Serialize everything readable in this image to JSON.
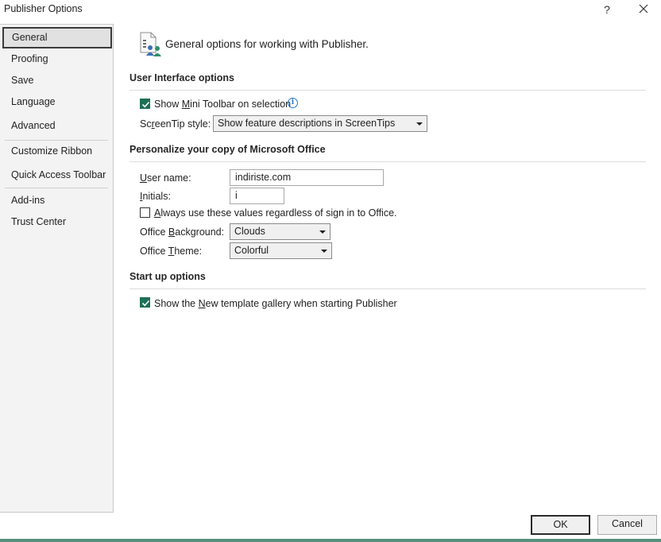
{
  "window": {
    "title": "Publisher Options",
    "help_label": "?",
    "close_icon": "close-icon"
  },
  "sidebar": {
    "items": [
      {
        "label": "General",
        "active": true
      },
      {
        "label": "Proofing"
      },
      {
        "label": "Save"
      },
      {
        "label": "Language"
      },
      {
        "label": "Advanced"
      },
      {
        "label": "Customize Ribbon"
      },
      {
        "label": "Quick Access Toolbar"
      },
      {
        "label": "Add-ins"
      },
      {
        "label": "Trust Center"
      }
    ]
  },
  "header": {
    "icon": "general-options-icon",
    "text": "General options for working with Publisher."
  },
  "ui_options": {
    "title": "User Interface options",
    "mini_toolbar": {
      "label_pre": "Show ",
      "label_u": "M",
      "label_post": "ini Toolbar on selection",
      "checked": true
    },
    "screentip": {
      "label_pre": "Sc",
      "label_u": "r",
      "label_post": "eenTip style:",
      "value": "Show feature descriptions in ScreenTips"
    }
  },
  "personalize": {
    "title": "Personalize your copy of Microsoft Office",
    "username": {
      "label_pre": "",
      "label_u": "U",
      "label_post": "ser name:",
      "value": "indiriste.com"
    },
    "initials": {
      "label_pre": "",
      "label_u": "I",
      "label_post": "nitials:",
      "value": "i"
    },
    "always_use": {
      "label_pre": "",
      "label_u": "A",
      "label_post": "lways use these values regardless of sign in to Office.",
      "checked": false
    },
    "background": {
      "label_pre": "Office ",
      "label_u": "B",
      "label_post": "ackground:",
      "value": "Clouds"
    },
    "theme": {
      "label_pre": "Office ",
      "label_u": "T",
      "label_post": "heme:",
      "value": "Colorful"
    }
  },
  "startup": {
    "title": "Start up options",
    "gallery": {
      "label_pre": "Show the ",
      "label_u": "N",
      "label_post": "ew template gallery when starting Publisher",
      "checked": true
    }
  },
  "footer": {
    "ok_label": "OK",
    "cancel_label": "Cancel"
  },
  "colors": {
    "accent": "#1f6f57",
    "info": "#2a78c8"
  }
}
